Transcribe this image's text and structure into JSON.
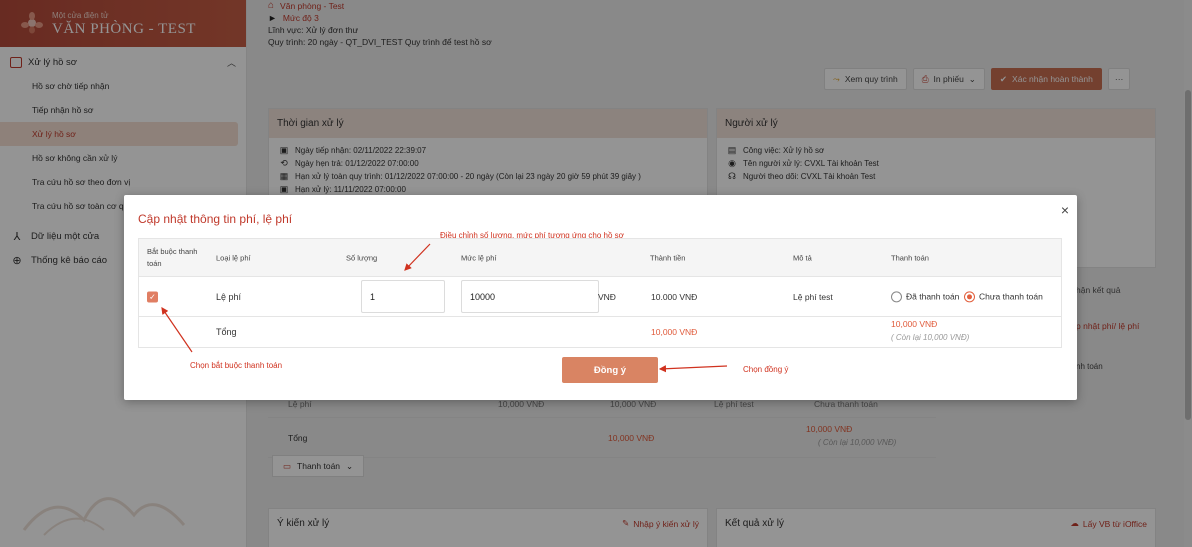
{
  "sidebar": {
    "brand_sub": "Một cửa điện tử",
    "brand_name": "VĂN PHÒNG - TEST",
    "group_label": "Xử lý hồ sơ",
    "items": [
      {
        "label": "Hồ sơ chờ tiếp nhận"
      },
      {
        "label": "Tiếp nhận hồ sơ"
      },
      {
        "label": "Xử lý hồ sơ"
      },
      {
        "label": "Hồ sơ không cần xử lý"
      },
      {
        "label": "Tra cứu hồ sơ theo đơn vị"
      },
      {
        "label": "Tra cứu hồ sơ toàn cơ q"
      }
    ],
    "top_items": [
      {
        "label": "Dữ liệu một cửa"
      },
      {
        "label": "Thống kê báo cáo"
      }
    ]
  },
  "info": {
    "office": "Văn phòng - Test",
    "level": "Mức độ 3",
    "field": "Lĩnh vực: Xử lý đơn thư",
    "process": "Quy trình: 20 ngày - QT_DVI_TEST Quy trình để test hồ sơ"
  },
  "toolbar": {
    "view_process": "Xem quy trình",
    "print": "In phiếu",
    "confirm": "Xác nhận hoàn thành",
    "more": "···"
  },
  "time_card": {
    "title": "Thời gian xử lý",
    "received": "Ngày tiếp nhận: 02/11/2022 22:39:07",
    "appointment": "Ngày hẹn trả: 01/12/2022 07:00:00",
    "deadline": "Hạn xử lý toàn quy trình: 01/12/2022 07:00:00 - 20 ngày (Còn lại 23 ngày 20 giờ 59 phút 39 giây )",
    "partial": "Hạn xử lý: 11/11/2022 07:00:00"
  },
  "handler_card": {
    "title": "Người xử lý",
    "task": "Công việc: Xử lý hồ sơ",
    "handler": "Tên người xử lý: CVXL Tài khoản Test",
    "follower": "Người theo dõi: CVXL Tài khoản Test"
  },
  "bg": {
    "result_label": "hận kết quả",
    "update_fee": "p nhật phí/ lệ phí",
    "pay_col": "nh toán",
    "row_fee_name": "Lệ phí",
    "row_qty_amount": "10,000 VNĐ",
    "row_total_amount": "10,000 VNĐ",
    "row_desc": "Lệ phí test",
    "row_status": "Chưa thanh toán",
    "total_label": "Tổng",
    "total_amount": "10,000 VNĐ",
    "total_right": "10,000 VNĐ",
    "total_remaining": "( Còn lại 10,000 VNĐ)",
    "pay_button": "Thanh toán",
    "opinion_title": "Ý kiến xử lý",
    "opinion_action": "Nhập ý kiến xử lý",
    "result_title": "Kết quả xử lý",
    "result_action": "Lấy VB từ iOffice"
  },
  "modal": {
    "title": "Cập nhật thông tin phí, lệ phí",
    "close": "×",
    "headers": {
      "required": "Bắt buộc thanh toán",
      "fee_type": "Loại lệ phí",
      "quantity": "Số lượng",
      "fee_amount": "Mức lệ phí",
      "total": "Thành tiền",
      "description": "Mô tả",
      "payment": "Thanh toán"
    },
    "row": {
      "checked_mark": "✓",
      "fee_type": "Lệ phí",
      "quantity": "1",
      "fee_amount": "10000",
      "currency": "VNĐ",
      "total": "10.000 VNĐ",
      "description": "Lệ phí test",
      "paid_option": "Đã thanh toán",
      "unpaid_option": "Chưa thanh toán"
    },
    "total_row": {
      "label": "Tổng",
      "amount": "10,000 VNĐ",
      "payment_amount": "10,000 VNĐ",
      "remaining": "( Còn lại 10,000 VNĐ)"
    },
    "confirm_button": "Đồng ý"
  },
  "annotations": {
    "adjust": "Điều chỉnh số lượng, mức phí tương ứng cho hồ sơ",
    "choose_required": "Chọn bắt buộc thanh toán",
    "choose_agree": "Chọn đồng ý"
  },
  "colors": {
    "accent": "#c0392b",
    "primary_button": "#d98463",
    "annotation": "#d0321f"
  }
}
